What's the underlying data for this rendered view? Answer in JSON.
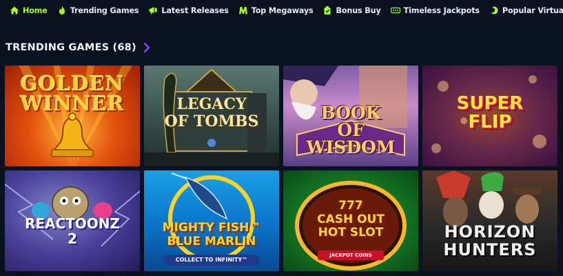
{
  "nav": {
    "items": [
      {
        "label": "Home",
        "icon": "home-icon",
        "active": true
      },
      {
        "label": "Trending Games",
        "icon": "flame-icon",
        "active": false
      },
      {
        "label": "Latest Releases",
        "icon": "megaphone-icon",
        "active": false
      },
      {
        "label": "Top Megaways",
        "icon": "megaways-m-icon",
        "active": false
      },
      {
        "label": "Bonus Buy",
        "icon": "bonus-bag-icon",
        "active": false
      },
      {
        "label": "Timeless Jackpots",
        "icon": "jackpot-dots-icon",
        "active": false
      },
      {
        "label": "Popular Virtuals",
        "icon": "virtuals-globe-icon",
        "active": false
      }
    ]
  },
  "section": {
    "title": "TRENDING GAMES (68)",
    "arrow_icon": "chevron-right-icon"
  },
  "games": [
    {
      "title_art": "GOLDEN\nWINNER"
    },
    {
      "title_art": "LEGACY\nOF TOMBS"
    },
    {
      "title_art": "BOOK\nOF\nWISDOM"
    },
    {
      "title_art": "SUPER\nFLIP"
    },
    {
      "title_art": "REACTOONZ\n2"
    },
    {
      "title_art": "MIGHTY FISH™\nBLUE MARLIN",
      "sub_art": "COLLECT TO INFINITY™"
    },
    {
      "title_art": "777\nCASH OUT\nHOT SLOT",
      "sub_art": "JACKPOT COINS"
    },
    {
      "title_art": "HORIZON\nHUNTERS"
    }
  ],
  "colors": {
    "background": "#0a1220",
    "active_nav": "#a9ff1c",
    "nav_text": "#e8edf4",
    "accent_arrow": "#7a4cff"
  }
}
